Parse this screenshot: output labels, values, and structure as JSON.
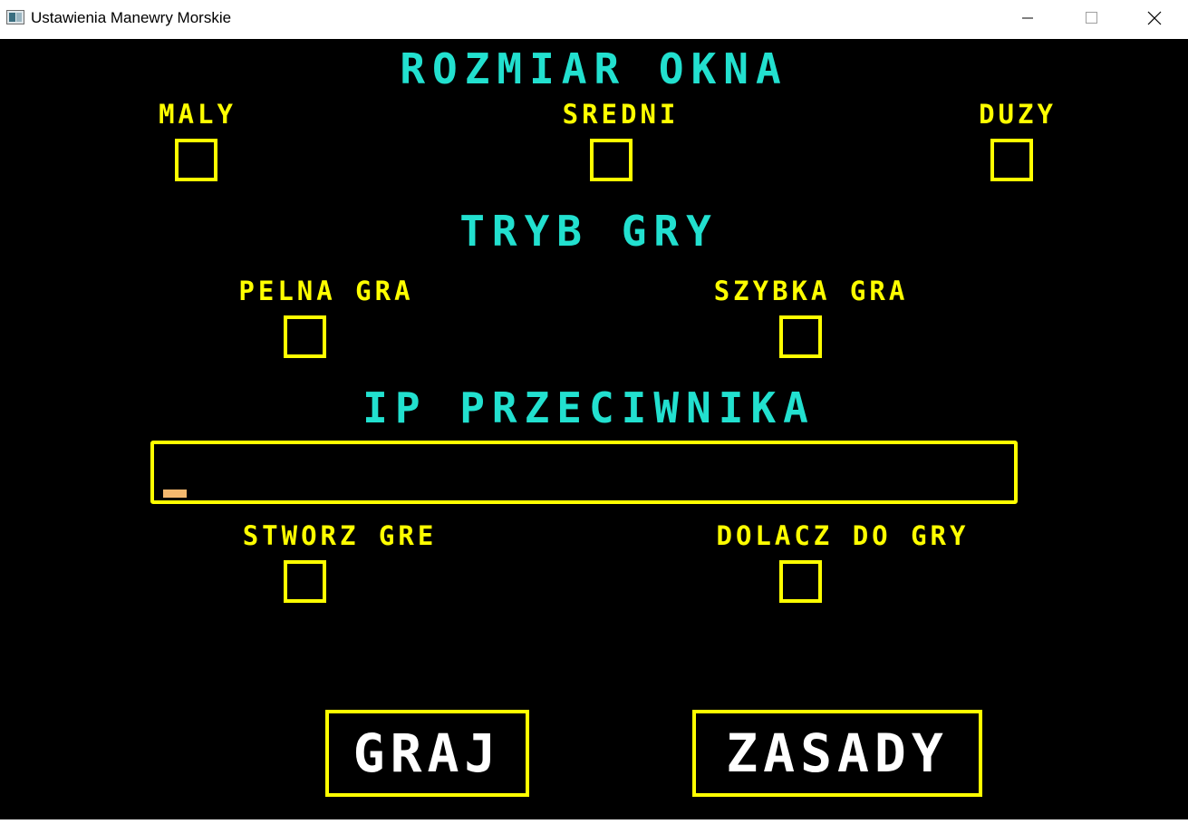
{
  "window": {
    "title": "Ustawienia Manewry Morskie",
    "icon": "app-window-icon",
    "controls": [
      "minimize-icon",
      "maximize-icon",
      "close-icon"
    ]
  },
  "colors": {
    "background": "#000000",
    "heading": "#22e0cf",
    "label": "#ffff00",
    "border": "#ffff00",
    "button_text": "#ffffff",
    "cursor": "#f4b86e"
  },
  "window_size": {
    "heading": "ROZMIAR OKNA",
    "options": [
      {
        "label": "MALY",
        "checked": false
      },
      {
        "label": "SREDNI",
        "checked": false
      },
      {
        "label": "DUZY",
        "checked": false
      }
    ]
  },
  "game_mode": {
    "heading": "TRYB GRY",
    "options": [
      {
        "label": "PELNA GRA",
        "checked": false
      },
      {
        "label": "SZYBKA GRA",
        "checked": false
      }
    ]
  },
  "opponent_ip": {
    "heading": "IP PRZECIWNIKA",
    "value": ""
  },
  "connection": {
    "options": [
      {
        "label": "STWORZ GRE",
        "checked": false
      },
      {
        "label": "DOLACZ DO GRY",
        "checked": false
      }
    ]
  },
  "buttons": {
    "play": "GRAJ",
    "rules": "ZASADY"
  }
}
